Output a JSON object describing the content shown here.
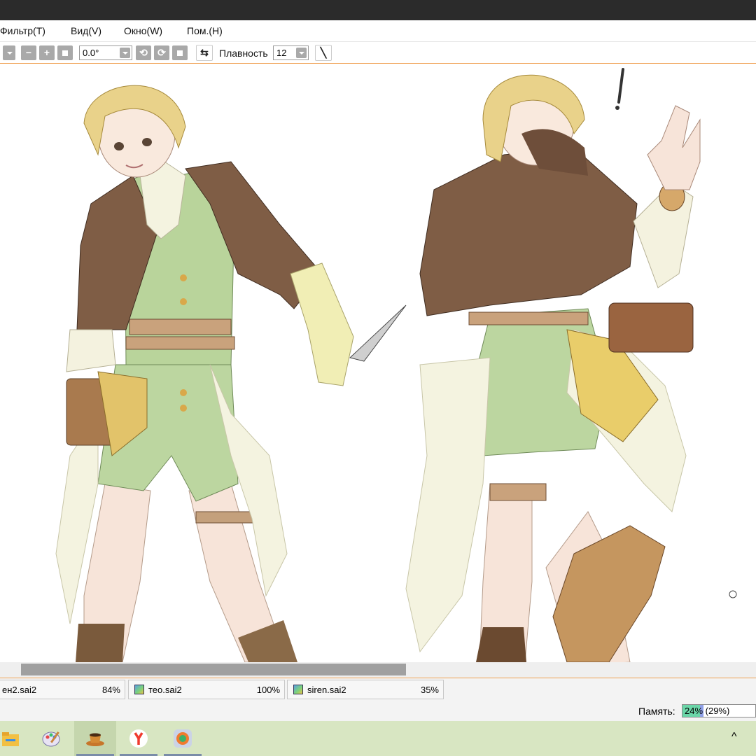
{
  "menu": [
    {
      "label": "Фильтр(T)",
      "key": "filter"
    },
    {
      "label": "Вид(V)",
      "key": "view"
    },
    {
      "label": "Окно(W)",
      "key": "window"
    },
    {
      "label": "Пом.(H)",
      "key": "help"
    }
  ],
  "toolbar": {
    "rotation_value": "0.0°",
    "smoothing_label": "Плавность",
    "smoothing_value": "12"
  },
  "scrollbar": {
    "position": 0.03,
    "visible_fraction": 0.51
  },
  "documents": [
    {
      "name": "ен2.sai2",
      "zoom": "84%"
    },
    {
      "name": "тео.sai2",
      "zoom": "100%"
    },
    {
      "name": "siren.sai2",
      "zoom": "35%"
    }
  ],
  "status": {
    "memory_label": "Память:",
    "memory_text": "24% (29%)",
    "memory_used": 0.24,
    "memory_peak": 0.29
  },
  "taskbar": {
    "apps": [
      {
        "icon": "file-explorer-icon",
        "active": false
      },
      {
        "icon": "paint-palette-icon",
        "active": false
      },
      {
        "icon": "sai-coffee-cup-icon",
        "active": true
      },
      {
        "icon": "yandex-browser-icon",
        "active": false
      },
      {
        "icon": "browser-app-icon",
        "active": false
      }
    ],
    "tray_chevron": "^"
  },
  "colors": {
    "accent_orange": "#f0a050",
    "taskbar_bg": "#d8e6c2",
    "memory_fill": "#6ad6a8"
  }
}
